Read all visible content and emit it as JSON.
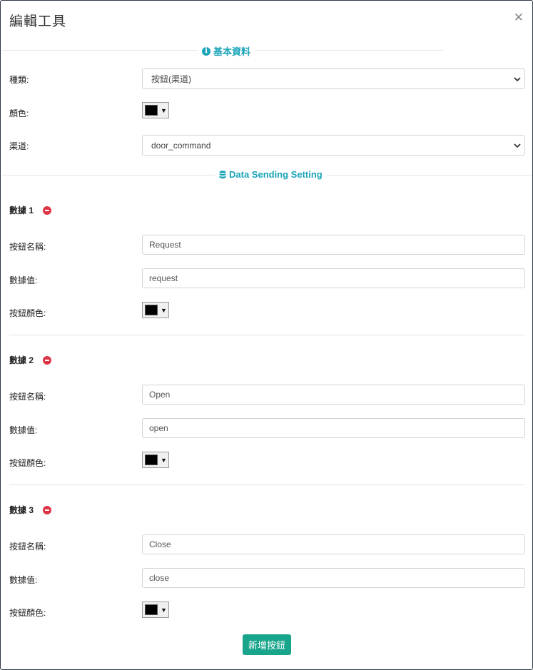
{
  "modal": {
    "title": "編輯工具"
  },
  "basic_section": {
    "title": "基本資料"
  },
  "type_field": {
    "label": "種類:",
    "value": "按鈕(渠道)"
  },
  "color_field": {
    "label": "顏色:",
    "color": "#000000"
  },
  "channel_field": {
    "label": "渠道:",
    "value": "door_command"
  },
  "data_section": {
    "title": "Data Sending Setting"
  },
  "data_items": [
    {
      "header": "數據 1",
      "name_label": "按鈕名稱:",
      "name_value": "Request",
      "value_label": "數據值:",
      "value_value": "request",
      "color_label": "按鈕顏色:",
      "color": "#000000"
    },
    {
      "header": "數據 2",
      "name_label": "按鈕名稱:",
      "name_value": "Open",
      "value_label": "數據值:",
      "value_value": "open",
      "color_label": "按鈕顏色:",
      "color": "#000000"
    },
    {
      "header": "數據 3",
      "name_label": "按鈕名稱:",
      "name_value": "Close",
      "value_label": "數據值:",
      "value_value": "close",
      "color_label": "按鈕顏色:",
      "color": "#000000"
    }
  ],
  "add_button": {
    "label": "新增按鈕"
  },
  "colors": {
    "accent": "#1aa4b8",
    "add_button": "#19a58b",
    "remove": "#dc3545"
  }
}
